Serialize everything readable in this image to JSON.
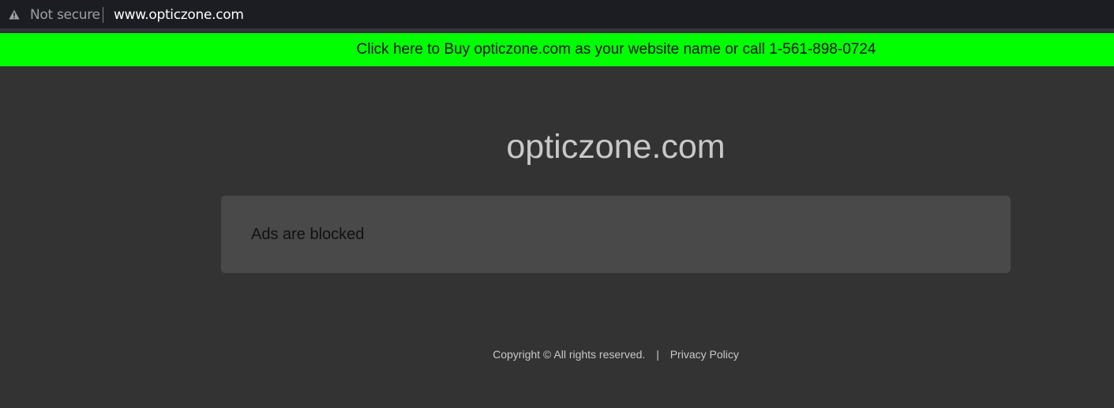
{
  "browser": {
    "security_label": "Not secure",
    "url": "www.opticzone.com"
  },
  "promo": {
    "text": "Click here to Buy opticzone.com as your website name or call 1-561-898-0724",
    "background_color": "#00ff00"
  },
  "main": {
    "site_title": "opticzone.com",
    "ads_message": "Ads are blocked"
  },
  "footer": {
    "copyright": "Copyright © All rights reserved.",
    "separator": "|",
    "privacy_link": "Privacy Policy"
  }
}
